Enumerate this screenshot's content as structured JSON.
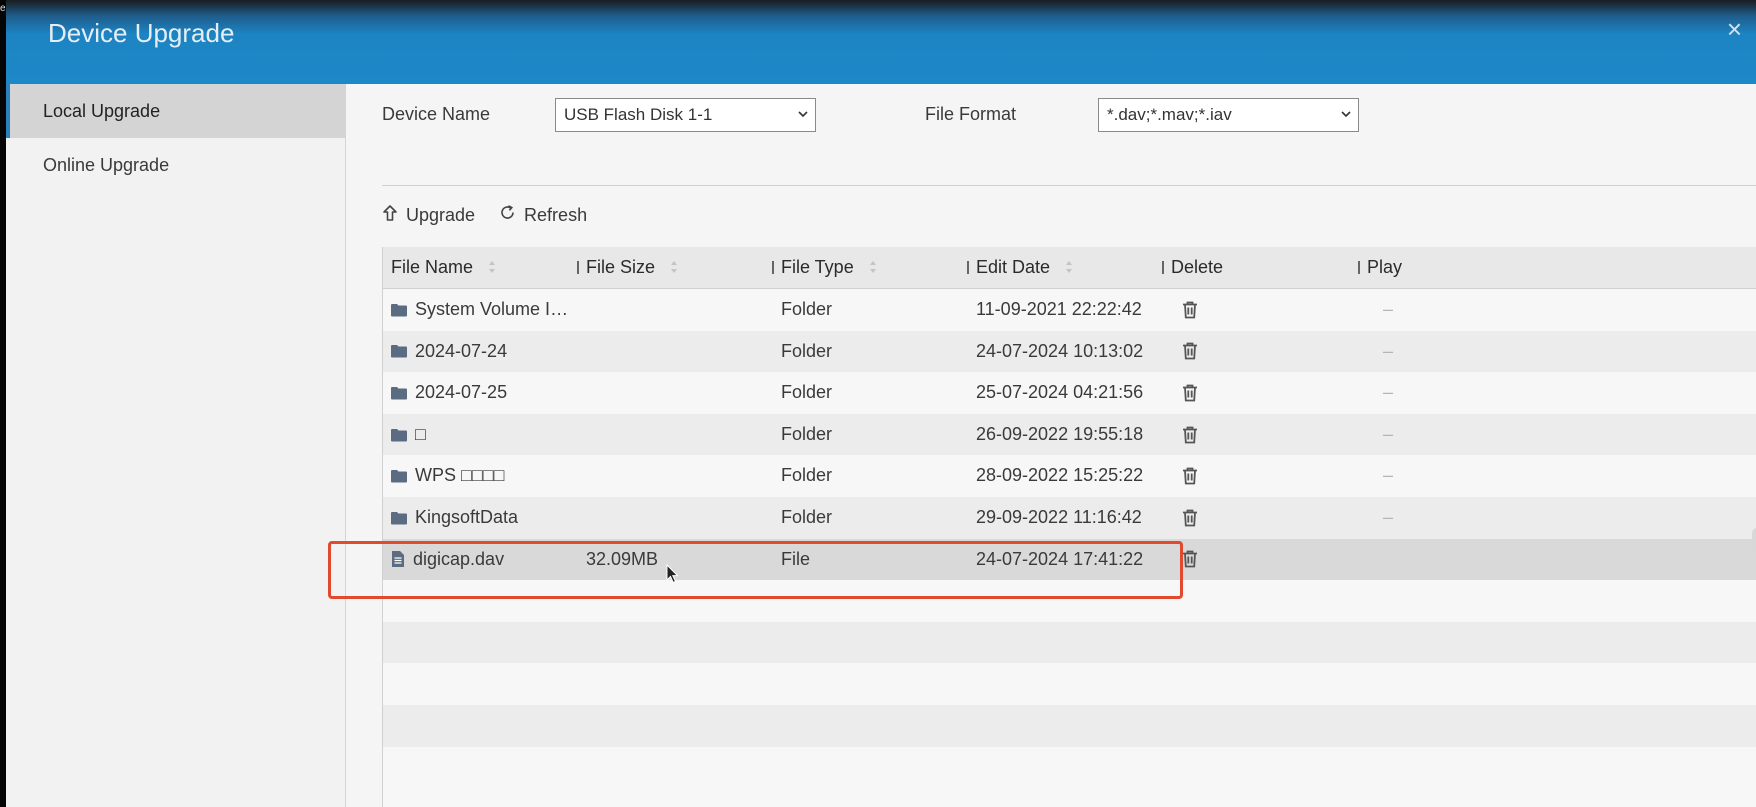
{
  "dialog": {
    "title": "Device Upgrade",
    "close_label": "×"
  },
  "edge_glyph": "e",
  "sidebar": {
    "items": [
      {
        "label": "Local Upgrade",
        "active": true
      },
      {
        "label": "Online Upgrade",
        "active": false
      }
    ]
  },
  "form": {
    "device_name_label": "Device Name",
    "device_name_value": "USB Flash Disk 1-1",
    "file_format_label": "File Format",
    "file_format_value": "*.dav;*.mav;*.iav"
  },
  "toolbar": {
    "upgrade_label": "Upgrade",
    "refresh_label": "Refresh"
  },
  "table": {
    "headers": {
      "file_name": "File Name",
      "file_size": "File Size",
      "file_type": "File Type",
      "edit_date": "Edit Date",
      "delete": "Delete",
      "play": "Play"
    },
    "rows": [
      {
        "name": "System Volume Inf...",
        "size": "",
        "type": "Folder",
        "date": "11-09-2021 22:22:42",
        "play": "–",
        "icon": "folder-icon"
      },
      {
        "name": "2024-07-24",
        "size": "",
        "type": "Folder",
        "date": "24-07-2024 10:13:02",
        "play": "–",
        "icon": "folder-icon"
      },
      {
        "name": "2024-07-25",
        "size": "",
        "type": "Folder",
        "date": "25-07-2024 04:21:56",
        "play": "–",
        "icon": "folder-icon"
      },
      {
        "name": "□",
        "size": "",
        "type": "Folder",
        "date": "26-09-2022 19:55:18",
        "play": "–",
        "icon": "folder-icon"
      },
      {
        "name": "WPS □□□□",
        "size": "",
        "type": "Folder",
        "date": "28-09-2022 15:25:22",
        "play": "–",
        "icon": "folder-icon"
      },
      {
        "name": "KingsoftData",
        "size": "",
        "type": "Folder",
        "date": "29-09-2022 11:16:42",
        "play": "–",
        "icon": "folder-icon"
      },
      {
        "name": "digicap.dav",
        "size": "32.09MB",
        "type": "File",
        "date": "24-07-2024 17:41:22",
        "play": "",
        "icon": "file-icon",
        "selected": true
      }
    ]
  },
  "colors": {
    "titlebar": "#1d88c7",
    "accent": "#2a7fbd",
    "highlight_box": "#e24a2f"
  }
}
